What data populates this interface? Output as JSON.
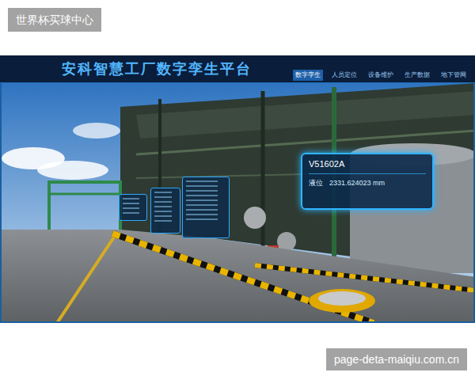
{
  "watermark_top": "世界杯买球中心",
  "watermark_bottom": "page-deta-maiqiu.com.cn",
  "header": {
    "title": "安科智慧工厂数字孪生平台"
  },
  "nav": [
    {
      "label": "数字孪生",
      "selected": true
    },
    {
      "label": "人员定位",
      "selected": false
    },
    {
      "label": "设备维护",
      "selected": false
    },
    {
      "label": "生产数据",
      "selected": false
    },
    {
      "label": "地下管网",
      "selected": false
    }
  ],
  "tag_panel": {
    "name": "V51602A",
    "label": "液位",
    "value": "2331.624023 mm"
  }
}
